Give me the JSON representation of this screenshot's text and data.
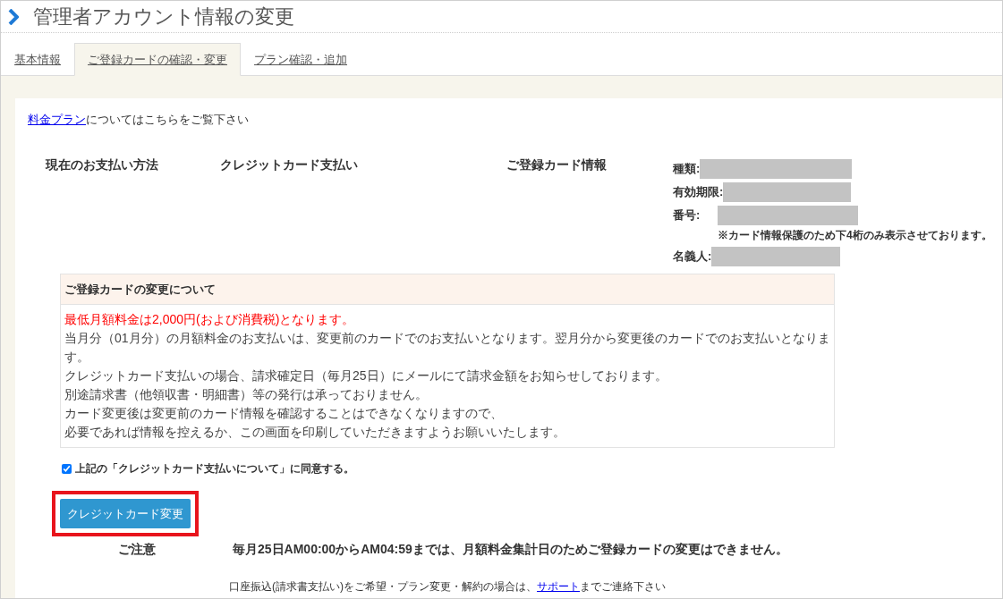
{
  "header": {
    "title": "管理者アカウント情報の変更"
  },
  "tabs": [
    {
      "label": "基本情報",
      "selected": false
    },
    {
      "label": "ご登録カードの確認・変更",
      "selected": true
    },
    {
      "label": "プラン確認・追加",
      "selected": false
    }
  ],
  "plan_note": {
    "link": "料金プラン",
    "text": "についてはこちらをご覧下さい"
  },
  "payment": {
    "label": "現在のお支払い方法",
    "value": "クレジットカード支払い"
  },
  "card_info": {
    "label": "ご登録カード情報",
    "fields": [
      {
        "label": "種類:"
      },
      {
        "label": "有効期限:"
      },
      {
        "label": "番号:",
        "note": "※カード情報保護のため下4桁のみ表示させております。"
      },
      {
        "label": "名義人:"
      }
    ]
  },
  "notice": {
    "title": "ご登録カードの変更について",
    "lines": [
      {
        "text": "最低月額料金は2,000円(および消費税)となります。",
        "kind": "warning"
      },
      {
        "text": "当月分（01月分）の月額料金のお支払いは、変更前のカードでのお支払いとなります。翌月分から変更後のカードでのお支払いとなります。",
        "kind": "normal"
      },
      {
        "text": "クレジットカード支払いの場合、請求確定日（毎月25日）にメールにて請求金額をお知らせしております。",
        "kind": "normal"
      },
      {
        "text": "別途請求書（他領収書・明細書）等の発行は承っておりません。",
        "kind": "normal"
      },
      {
        "text": "カード変更後は変更前のカード情報を確認することはできなくなりますので、",
        "kind": "normal"
      },
      {
        "text": "必要であれば情報を控えるか、この画面を印刷していただきますようお願いいたします。",
        "kind": "normal"
      }
    ]
  },
  "agree": {
    "label": "上記の「クレジットカード支払いについて」に同意する。",
    "checked": true
  },
  "change_button": {
    "label": "クレジットカード変更",
    "highlighted": true
  },
  "caution": {
    "label": "ご注意",
    "text": "毎月25日AM00:00からAM04:59までは、月額料金集計日のためご登録カードの変更はできません。"
  },
  "footer": {
    "before": "口座振込(請求書支払い)をご希望・プラン変更・解約の場合は、",
    "link": "サポート",
    "after": "までご連絡下さい"
  }
}
